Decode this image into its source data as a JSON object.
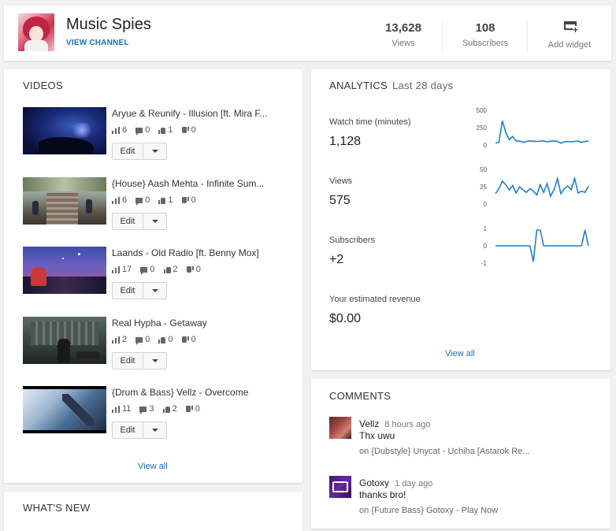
{
  "channel": {
    "name": "Music Spies",
    "view_channel": "VIEW CHANNEL",
    "views_value": "13,628",
    "views_label": "Views",
    "subs_value": "108",
    "subs_label": "Subscribers",
    "add_widget": "Add widget"
  },
  "videos": {
    "title": "VIDEOS",
    "edit_label": "Edit",
    "view_all": "View all",
    "items": [
      {
        "title": "Aryue & Reunify - Illusion [ft. Mira F...",
        "views": "6",
        "comments": "0",
        "likes": "1",
        "dislikes": "0"
      },
      {
        "title": "{House} Aash Mehta - Infinite Sum...",
        "views": "6",
        "comments": "0",
        "likes": "1",
        "dislikes": "0"
      },
      {
        "title": "Laands - Old Radio [ft. Benny Mox]",
        "views": "17",
        "comments": "0",
        "likes": "2",
        "dislikes": "0"
      },
      {
        "title": "Real Hypha - Getaway",
        "views": "2",
        "comments": "0",
        "likes": "0",
        "dislikes": "0"
      },
      {
        "title": "{Drum & Bass} Vellz - Overcome",
        "views": "11",
        "comments": "3",
        "likes": "2",
        "dislikes": "0"
      }
    ]
  },
  "analytics": {
    "title": "ANALYTICS",
    "period": "Last 28 days",
    "watch_label": "Watch time (minutes)",
    "watch_value": "1,128",
    "views_label": "Views",
    "views_value": "575",
    "subs_label": "Subscribers",
    "subs_value": "+2",
    "revenue_label": "Your estimated revenue",
    "revenue_value": "$0.00",
    "view_all": "View all",
    "watch_ticks": [
      "500",
      "250",
      "0"
    ],
    "views_ticks": [
      "50",
      "25",
      "0"
    ],
    "subs_ticks": [
      "1",
      "0",
      "-1"
    ],
    "line_color": "#1e7fcb"
  },
  "chart_data": [
    {
      "type": "line",
      "title": "Watch time (minutes)",
      "ylim": [
        0,
        500
      ],
      "x": [
        1,
        2,
        3,
        4,
        5,
        6,
        7,
        8,
        9,
        10,
        11,
        12,
        13,
        14,
        15,
        16,
        17,
        18,
        19,
        20,
        21,
        22,
        23,
        24,
        25,
        26,
        27,
        28
      ],
      "values": [
        5,
        20,
        360,
        170,
        60,
        110,
        35,
        40,
        15,
        30,
        40,
        35,
        30,
        35,
        40,
        25,
        35,
        40,
        30,
        5,
        25,
        30,
        25,
        30,
        35,
        15,
        30,
        40
      ]
    },
    {
      "type": "line",
      "title": "Views",
      "ylim": [
        0,
        50
      ],
      "x": [
        1,
        2,
        3,
        4,
        5,
        6,
        7,
        8,
        9,
        10,
        11,
        12,
        13,
        14,
        15,
        16,
        17,
        18,
        19,
        20,
        21,
        22,
        23,
        24,
        25,
        26,
        27,
        28
      ],
      "values": [
        14,
        22,
        34,
        28,
        20,
        27,
        15,
        25,
        20,
        16,
        22,
        18,
        12,
        28,
        16,
        30,
        10,
        20,
        38,
        14,
        22,
        26,
        20,
        38,
        15,
        18,
        16,
        26
      ]
    },
    {
      "type": "line",
      "title": "Subscribers",
      "ylim": [
        -1,
        1
      ],
      "x": [
        1,
        2,
        3,
        4,
        5,
        6,
        7,
        8,
        9,
        10,
        11,
        12,
        13,
        14,
        15,
        16,
        17,
        18,
        19,
        20,
        21,
        22,
        23,
        24,
        25,
        26,
        27,
        28
      ],
      "values": [
        0,
        0,
        0,
        0,
        0,
        0,
        0,
        0,
        0,
        0,
        0,
        -1,
        1,
        1,
        0,
        0,
        0,
        0,
        0,
        0,
        0,
        0,
        0,
        0,
        0,
        0,
        1,
        0
      ]
    }
  ],
  "comments": {
    "title": "COMMENTS",
    "items": [
      {
        "user": "Vellz",
        "time": "8 hours ago",
        "text": "Thx uwu",
        "on": "on {Dubstyle} Unycat - Uchiha [Astarok Re..."
      },
      {
        "user": "Gotoxy",
        "time": "1 day ago",
        "text": "thanks bro!",
        "on": "on {Future Bass} Gotoxy - Play Now"
      }
    ]
  },
  "whats_new": {
    "title": "WHAT'S NEW"
  }
}
